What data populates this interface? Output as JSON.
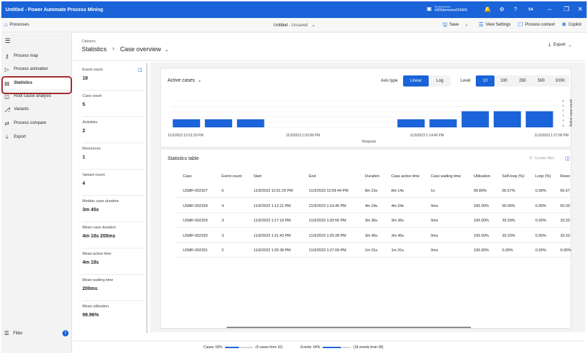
{
  "app": {
    "title": "Untitled - Power Automate Process Mining",
    "environment_label": "Environment",
    "environment_value": "d365demotoo656906",
    "initials": "SA"
  },
  "commandbar": {
    "processes": "Processes",
    "doc_title": "Untitled",
    "doc_state": "- Unsaved",
    "save": "Save",
    "view_settings": "View Settings",
    "process_context": "Process context",
    "copilot": "Copilot"
  },
  "nav": {
    "items": [
      {
        "label": "Process map",
        "icon": "process-map-icon"
      },
      {
        "label": "Process animation",
        "icon": "play-icon"
      },
      {
        "label": "Statistics",
        "icon": "statistics-icon"
      },
      {
        "label": "Root cause analysis",
        "icon": "root-cause-icon"
      },
      {
        "label": "Variants",
        "icon": "variants-icon"
      },
      {
        "label": "Process compare",
        "icon": "compare-icon"
      },
      {
        "label": "Export",
        "icon": "export-icon"
      }
    ],
    "filter": "Filter",
    "filter_count": "1"
  },
  "header": {
    "category_label": "Category",
    "category": "Statistics",
    "view": "Case overview",
    "export": "Export"
  },
  "metrics": [
    {
      "label": "Event count",
      "value": "18"
    },
    {
      "label": "Case count",
      "value": "5"
    },
    {
      "label": "Activities",
      "value": "2"
    },
    {
      "label": "Resources",
      "value": "1"
    },
    {
      "label": "Variant count",
      "value": "4"
    },
    {
      "label": "Median case duration",
      "value": "3m 45s"
    },
    {
      "label": "Mean case duration",
      "value": "4m 18s 200ms"
    },
    {
      "label": "Mean active time",
      "value": "4m 18s"
    },
    {
      "label": "Mean waiting time",
      "value": "200ms"
    },
    {
      "label": "Mean utilization",
      "value": "99.96%"
    }
  ],
  "chart_controls": {
    "title": "Active cases",
    "axis_type_label": "Axis type",
    "axis_options": [
      "Linear",
      "Log"
    ],
    "axis_selected": "Linear",
    "level_label": "Level",
    "level_options": [
      "10",
      "100",
      "250",
      "500",
      "1000"
    ],
    "level_selected": "10"
  },
  "chart_data": {
    "type": "bar",
    "title": "Active cases",
    "xlabel": "Temporal",
    "ylabel": "Active case count",
    "x_tick_labels": [
      "11/3/2023 12:51:29 PM",
      "11/3/2023 1:03:58 PM",
      "11/3/2023 1:14:40 PM",
      "11/3/2023 1:27:08 PM"
    ],
    "y_ticks": [
      "3",
      "2",
      "2",
      "1",
      "1",
      "0"
    ],
    "ylim": [
      0,
      3
    ],
    "values": [
      1,
      1,
      1,
      0,
      0,
      0,
      0,
      1,
      1,
      2,
      2,
      2
    ],
    "bar_color": "#1a63d8"
  },
  "statistics_table": {
    "title": "Statistics table",
    "create_filter": "Create filter",
    "columns": [
      "Case",
      "Event count",
      "Start",
      "End",
      "Duration",
      "Case active time",
      "Case waiting time",
      "Utilization",
      "Self-loop (%)",
      "Loop (%)",
      "Rewo"
    ],
    "rows": [
      [
        "USMF-002327",
        "6",
        "11/3/2023 12:51:29 PM",
        "11/3/2023 12:59:44 PM",
        "8m 15s",
        "8m 14s",
        "1s",
        "99.80%",
        "66.67%",
        "0.00%",
        "66.67"
      ],
      [
        "USMF-002328",
        "4",
        "11/3/2023 1:12:21 PM",
        "11/3/2023 1:16:45 PM",
        "4m 24s",
        "4m 24s",
        "0ms",
        "100.00%",
        "50.00%",
        "0.00%",
        "50.00"
      ],
      [
        "USMF-002329",
        "3",
        "11/3/2023 1:17:19 PM",
        "11/3/2023 1:20:55 PM",
        "3m 36s",
        "3m 36s",
        "0ms",
        "100.00%",
        "33.33%",
        "0.00%",
        "33.33"
      ],
      [
        "USMF-002330",
        "3",
        "11/3/2023 1:21:43 PM",
        "11/3/2023 1:25:28 PM",
        "3m 45s",
        "3m 45s",
        "0ms",
        "100.00%",
        "33.33%",
        "0.00%",
        "33.33"
      ],
      [
        "USMF-002331",
        "2",
        "11/3/2023 1:25:38 PM",
        "11/3/2023 1:27:09 PM",
        "1m 31s",
        "1m 31s",
        "0ms",
        "100.00%",
        "0.00%",
        "0.00%",
        "0.00%"
      ]
    ]
  },
  "status": {
    "cases_label": "Cases: 50%",
    "cases_fraction": 0.5,
    "cases_detail": "(5 cases from 10)",
    "events_label": "Events: 64%",
    "events_fraction": 0.64,
    "events_detail": "(18 events from 28)"
  }
}
